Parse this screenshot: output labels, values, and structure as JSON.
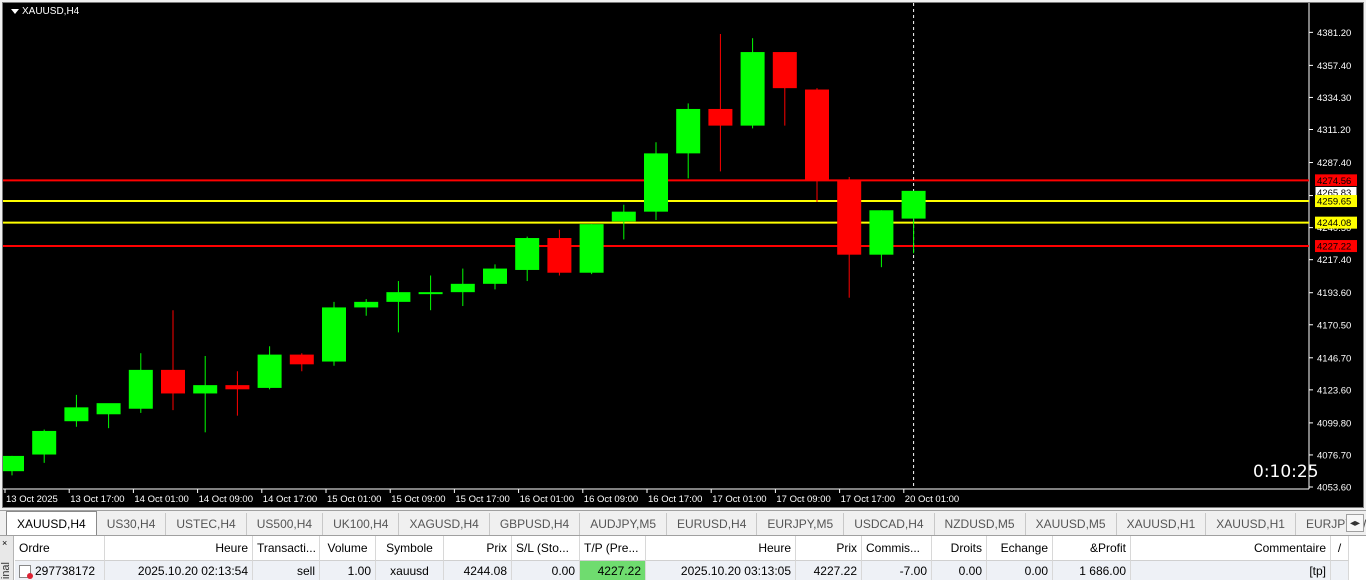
{
  "chart": {
    "symbol_title": "XAUUSD,H4",
    "countdown": "0:10:25",
    "colors": {
      "background": "#000000",
      "bull": "#00ff00",
      "bear": "#ff0000",
      "wick_bull": "#00ff00",
      "wick_bear": "#ff0000",
      "tp_line": "#ff0000",
      "entry_line": "#ffff00",
      "axis_text": "#ffffff"
    }
  },
  "chart_data": {
    "type": "candlestick",
    "ylim": [
      4053.6,
      4386.5
    ],
    "y_ticks": [
      "4381.20",
      "4357.40",
      "4334.30",
      "4311.20",
      "4287.40",
      "4263.60",
      "4240.50",
      "4217.40",
      "4193.60",
      "4170.50",
      "4146.70",
      "4123.60",
      "4099.80",
      "4076.70",
      "4053.60"
    ],
    "x_tick_labels": [
      "13 Oct 2025",
      "13 Oct 17:00",
      "14 Oct 01:00",
      "14 Oct 09:00",
      "14 Oct 17:00",
      "15 Oct 01:00",
      "15 Oct 09:00",
      "15 Oct 17:00",
      "16 Oct 01:00",
      "16 Oct 09:00",
      "16 Oct 17:00",
      "17 Oct 01:00",
      "17 Oct 09:00",
      "17 Oct 17:00",
      "20 Oct 01:00"
    ],
    "candles": [
      {
        "o": 4065,
        "h": 4076,
        "l": 4062,
        "c": 4076
      },
      {
        "o": 4077,
        "h": 4095,
        "l": 4071,
        "c": 4094
      },
      {
        "o": 4101,
        "h": 4120,
        "l": 4097,
        "c": 4111
      },
      {
        "o": 4106,
        "h": 4112,
        "l": 4096,
        "c": 4114
      },
      {
        "o": 4110,
        "h": 4150,
        "l": 4107,
        "c": 4138
      },
      {
        "o": 4138,
        "h": 4181,
        "l": 4109,
        "c": 4121
      },
      {
        "o": 4121,
        "h": 4148,
        "l": 4093,
        "c": 4127
      },
      {
        "o": 4127,
        "h": 4137,
        "l": 4105,
        "c": 4124
      },
      {
        "o": 4125,
        "h": 4155,
        "l": 4124,
        "c": 4149
      },
      {
        "o": 4149,
        "h": 4150,
        "l": 4137,
        "c": 4142
      },
      {
        "o": 4144,
        "h": 4187,
        "l": 4141,
        "c": 4183
      },
      {
        "o": 4183,
        "h": 4189,
        "l": 4177,
        "c": 4187
      },
      {
        "o": 4187,
        "h": 4202,
        "l": 4165,
        "c": 4194
      },
      {
        "o": 4194,
        "h": 4206,
        "l": 4181,
        "c": 4194
      },
      {
        "o": 4194,
        "h": 4211,
        "l": 4184,
        "c": 4200
      },
      {
        "o": 4200,
        "h": 4214,
        "l": 4196,
        "c": 4211
      },
      {
        "o": 4210,
        "h": 4234,
        "l": 4202,
        "c": 4233
      },
      {
        "o": 4233,
        "h": 4239,
        "l": 4206,
        "c": 4208
      },
      {
        "o": 4208,
        "h": 4243,
        "l": 4207,
        "c": 4243
      },
      {
        "o": 4245,
        "h": 4257,
        "l": 4232,
        "c": 4252
      },
      {
        "o": 4252,
        "h": 4302,
        "l": 4246,
        "c": 4294
      },
      {
        "o": 4294,
        "h": 4330,
        "l": 4276,
        "c": 4326
      },
      {
        "o": 4326,
        "h": 4380,
        "l": 4281,
        "c": 4314
      },
      {
        "o": 4314,
        "h": 4377,
        "l": 4312,
        "c": 4367
      },
      {
        "o": 4367,
        "h": 4367,
        "l": 4314,
        "c": 4341
      },
      {
        "o": 4340,
        "h": 4341,
        "l": 4259,
        "c": 4275
      },
      {
        "o": 4275,
        "h": 4277,
        "l": 4190,
        "c": 4221
      },
      {
        "o": 4221,
        "h": 4253,
        "l": 4212,
        "c": 4253
      },
      {
        "o": 4247,
        "h": 4267,
        "l": 4222,
        "c": 4267
      }
    ],
    "price_labels": [
      {
        "text": "4274.56",
        "value": 4274.56,
        "style": "tp"
      },
      {
        "text": "4265.83",
        "value": 4265.83,
        "style": "current"
      },
      {
        "text": "4259.65",
        "value": 4259.65,
        "style": "entry"
      },
      {
        "text": "4244.08",
        "value": 4244.08,
        "style": "entry"
      },
      {
        "text": "4227.22",
        "value": 4227.22,
        "style": "tp"
      }
    ],
    "horizontal_lines": [
      {
        "value": 4274.56,
        "color": "#ff0000"
      },
      {
        "value": 4259.65,
        "color": "#ffff00"
      },
      {
        "value": 4244.08,
        "color": "#ffff00"
      },
      {
        "value": 4227.22,
        "color": "#ff0000"
      }
    ],
    "crosshair_candle_index": 28
  },
  "tabs": [
    {
      "label": "XAUUSD,H4",
      "active": true
    },
    {
      "label": "US30,H4"
    },
    {
      "label": "USTEC,H4"
    },
    {
      "label": "US500,H4"
    },
    {
      "label": "UK100,H4"
    },
    {
      "label": "XAGUSD,H4"
    },
    {
      "label": "GBPUSD,H4"
    },
    {
      "label": "AUDJPY,M5"
    },
    {
      "label": "EURUSD,H4"
    },
    {
      "label": "EURJPY,M5"
    },
    {
      "label": "USDCAD,H4"
    },
    {
      "label": "NZDUSD,M5"
    },
    {
      "label": "XAUUSD,M5"
    },
    {
      "label": "XAUUSD,H1"
    },
    {
      "label": "XAUUSD,H1"
    },
    {
      "label": "EURJPY,Weekly"
    }
  ],
  "tab_scroll_icon": "◂▸",
  "terminal": {
    "side_label": "inal",
    "close_glyph": "×",
    "columns": [
      "Ordre",
      "Heure",
      "Transacti...",
      "Volume",
      "Symbole",
      "Prix",
      "S/L (Sto...",
      "T/P (Pre...",
      "Heure",
      "Prix",
      "Commis...",
      "Droits",
      "Echange",
      "&Profit",
      "Commentaire",
      "/"
    ],
    "row": [
      "297738172",
      "2025.10.20 02:13:54",
      "sell",
      "1.00",
      "xauusd",
      "4244.08",
      "0.00",
      "4227.22",
      "2025.10.20 03:13:05",
      "4227.22",
      "-7.00",
      "0.00",
      "0.00",
      "1 686.00",
      "[tp]",
      ""
    ]
  }
}
